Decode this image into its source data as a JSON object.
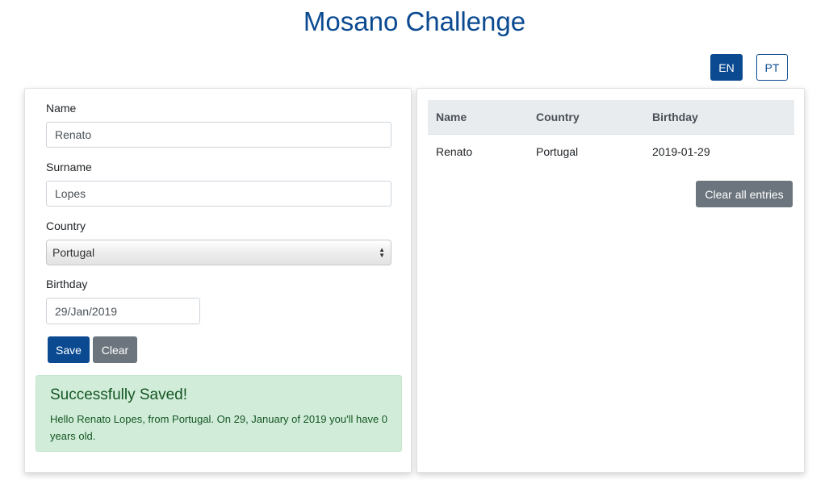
{
  "app": {
    "title": "Mosano Challenge"
  },
  "language": {
    "en_label": "EN",
    "pt_label": "PT",
    "active": "EN"
  },
  "form": {
    "name_label": "Name",
    "name_value": "Renato",
    "surname_label": "Surname",
    "surname_value": "Lopes",
    "country_label": "Country",
    "country_value": "Portugal",
    "birthday_label": "Birthday",
    "birthday_value": "29/Jan/2019",
    "save_label": "Save",
    "clear_label": "Clear"
  },
  "alert": {
    "heading": "Successfully Saved!",
    "message": "Hello Renato Lopes, from Portugal. On 29, January of 2019 you'll have 0 years old."
  },
  "table": {
    "headers": [
      "Name",
      "Country",
      "Birthday"
    ],
    "rows": [
      [
        "Renato",
        "Portugal",
        "2019-01-29"
      ]
    ],
    "clear_all_label": "Clear all entries"
  },
  "colors": {
    "primary": "#0b4a91",
    "secondary": "#6c757d",
    "success_bg": "#d1ecd9",
    "success_text": "#155724"
  }
}
